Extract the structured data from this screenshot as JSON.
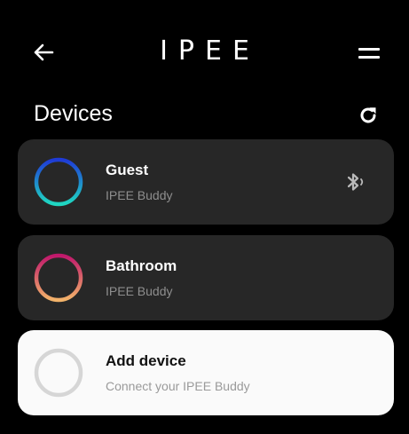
{
  "header": {
    "brand": "IPEE",
    "back_icon": "arrow-left-icon",
    "menu_icon": "menu-equals-icon"
  },
  "section": {
    "title": "Devices",
    "refresh_icon": "refresh-icon"
  },
  "devices": [
    {
      "name": "Guest",
      "type": "IPEE Buddy",
      "ring_colors": [
        "#1f3bd6",
        "#1fd8c2"
      ],
      "status_icon": "bluetooth-connected-icon"
    },
    {
      "name": "Bathroom",
      "type": "IPEE Buddy",
      "ring_colors": [
        "#c0186b",
        "#f2b36a"
      ]
    }
  ],
  "add_device": {
    "title": "Add device",
    "subtitle": "Connect your IPEE Buddy",
    "ring_color": "#d6d6d6"
  },
  "colors": {
    "background": "#000000",
    "card_dark": "#272727",
    "card_light": "#fafafa"
  }
}
